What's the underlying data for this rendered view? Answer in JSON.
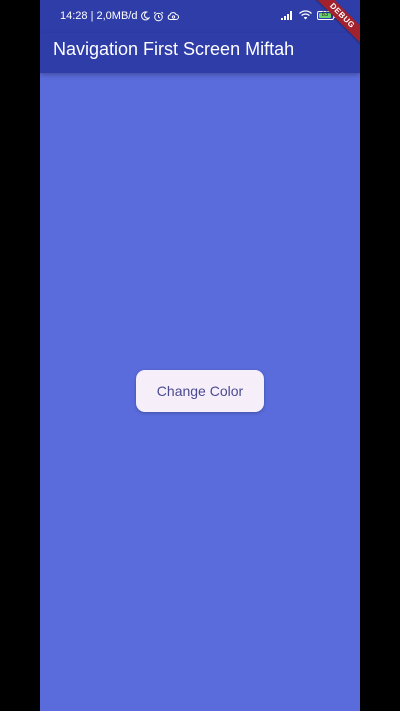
{
  "status_bar": {
    "time_network": "14:28 | 2,0MB/d",
    "left_icons": [
      "moon-icon",
      "alarm-icon",
      "cloud-sync-icon"
    ],
    "right_icons": [
      "cellular-signal-icon",
      "wifi-icon",
      "battery-icon"
    ],
    "battery_level": "83"
  },
  "app_bar": {
    "title": "Navigation First Screen Miftah"
  },
  "debug_banner": {
    "label": "DEBUG"
  },
  "main": {
    "button_label": "Change Color"
  },
  "colors": {
    "background": "#5a6bdb",
    "app_bar": "#2f3da8",
    "button_bg": "#f6effa",
    "button_text": "#4a4a8e",
    "debug_banner": "#a3212d"
  }
}
